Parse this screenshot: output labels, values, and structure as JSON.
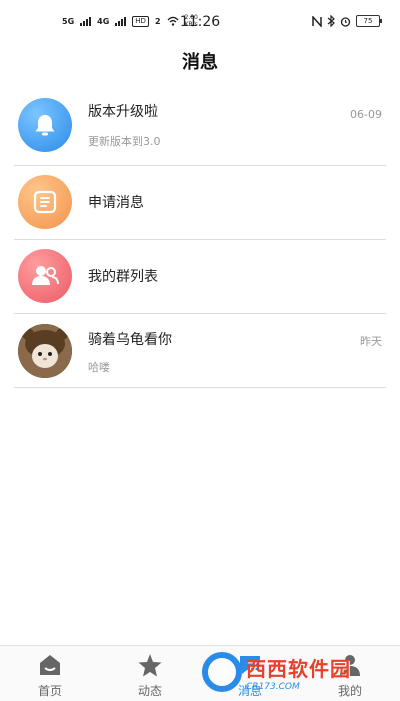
{
  "status_bar": {
    "net1": "5G",
    "net2": "4G",
    "hd": "HD",
    "hd_num": "2",
    "speed_value": "2.00",
    "speed_unit": "KB/s",
    "time": "11:26",
    "battery": "75"
  },
  "header": {
    "title": "消息"
  },
  "messages": [
    {
      "title": "版本升级啦",
      "subtitle": "更新版本到3.0",
      "time": "06-09",
      "icon": "bell-icon",
      "color": "#2a8be8"
    },
    {
      "title": "申请消息",
      "icon": "document-icon",
      "color": "#f3934a"
    },
    {
      "title": "我的群列表",
      "icon": "group-icon",
      "color": "#ec5a66"
    },
    {
      "title": "骑着乌龟看你",
      "subtitle": "哈喽",
      "time": "昨天",
      "icon": "user-photo"
    }
  ],
  "nav": {
    "items": [
      {
        "label": "首页",
        "icon": "home-icon"
      },
      {
        "label": "动态",
        "icon": "star-icon"
      },
      {
        "label": "消息",
        "icon": "message-icon",
        "active": true
      },
      {
        "label": "我的",
        "icon": "user-icon"
      }
    ],
    "active_color": "#2a8be8"
  },
  "watermark": {
    "main": "西西软件园",
    "sub": "CR173.COM"
  }
}
